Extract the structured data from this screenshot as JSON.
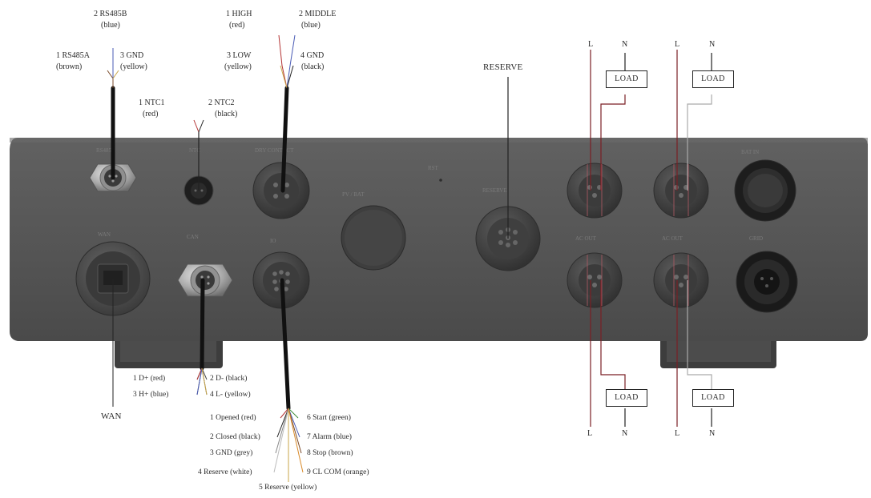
{
  "labels": {
    "rs485_pin2": "2 RS485B",
    "rs485_pin2_color": "(blue)",
    "rs485_pin1": "1 RS485A",
    "rs485_pin1_color": "(brown)",
    "rs485_pin3": "3 GND",
    "rs485_pin3_color": "(yellow)",
    "ntc_pin1": "1 NTC1",
    "ntc_pin1_color": "(red)",
    "ntc_pin2": "2 NTC2",
    "ntc_pin2_color": "(black)",
    "dry_high": "1 HIGH",
    "dry_high_color": "(red)",
    "dry_middle": "2 MIDDLE",
    "dry_middle_color": "(blue)",
    "dry_low": "3 LOW",
    "dry_low_color": "(yellow)",
    "dry_gnd": "4 GND",
    "dry_gnd_color": "(black)",
    "reserve": "RESERVE",
    "wan": "WAN",
    "can_d_plus": "1 D+ (red)",
    "can_d_minus": "2 D- (black)",
    "can_pin3": "3 H+ (blue)",
    "can_pin4": "4 L- (yellow)",
    "io_opened": "1 Opened (red)",
    "io_closed": "2 Closed (black)",
    "io_gnd": "3 GND (grey)",
    "io_reserve4": "4 Reserve (white)",
    "io_reserve5": "5 Reserve (yellow)",
    "io_start": "6 Start (green)",
    "io_alarm": "7 Alarm (blue)",
    "io_stop": "8 Stop (brown)",
    "io_cl_com": "9 CL COM (orange)"
  },
  "loads": [
    {
      "box": "LOAD",
      "l": "L",
      "n": "N"
    },
    {
      "box": "LOAD",
      "l": "L",
      "n": "N"
    },
    {
      "box": "LOAD",
      "l": "L",
      "n": "N"
    },
    {
      "box": "LOAD",
      "l": "L",
      "n": "N"
    }
  ],
  "colors": {
    "panel": "#555555",
    "panel_dark": "#3a3a3a",
    "cable": "#111111",
    "live_wire": "#7a1f24",
    "wire_blue": "#4a5bb5",
    "wire_red": "#b33333",
    "wire_yellow": "#c9a64a"
  }
}
